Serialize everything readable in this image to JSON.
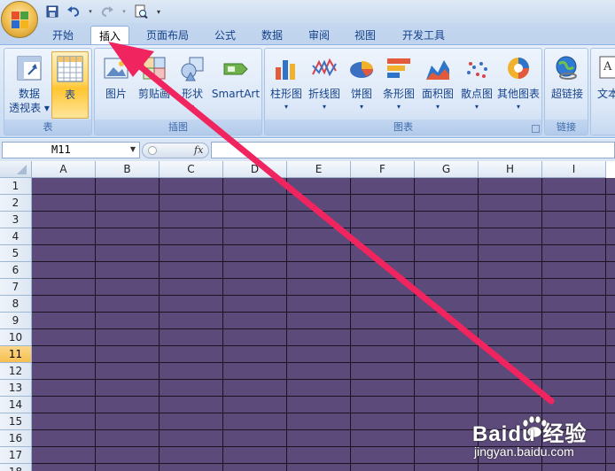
{
  "quick_access": {
    "items": [
      "save-icon",
      "undo-icon",
      "redo-icon",
      "print-preview-icon",
      "customize-icon"
    ]
  },
  "tabs": [
    {
      "label": "开始",
      "active": false
    },
    {
      "label": "插入",
      "active": true
    },
    {
      "label": "页面布局",
      "active": false
    },
    {
      "label": "公式",
      "active": false
    },
    {
      "label": "数据",
      "active": false
    },
    {
      "label": "审阅",
      "active": false
    },
    {
      "label": "视图",
      "active": false
    },
    {
      "label": "开发工具",
      "active": false
    }
  ],
  "ribbon": {
    "groups": {
      "table": {
        "label": "表",
        "buttons": [
          {
            "label": "数据",
            "label2": "透视表",
            "icon": "pivot-table-icon",
            "dropdown": true
          },
          {
            "label": "表",
            "icon": "table-icon",
            "highlighted": true
          }
        ]
      },
      "illustrations": {
        "label": "插图",
        "buttons": [
          {
            "label": "图片",
            "icon": "picture-icon"
          },
          {
            "label": "剪贴画",
            "icon": "clip-art-icon"
          },
          {
            "label": "形状",
            "icon": "shapes-icon",
            "dropdown": true
          },
          {
            "label": "SmartArt",
            "icon": "smartart-icon"
          }
        ]
      },
      "charts": {
        "label": "图表",
        "buttons": [
          {
            "label": "柱形图",
            "icon": "column-chart-icon",
            "dropdown": true
          },
          {
            "label": "折线图",
            "icon": "line-chart-icon",
            "dropdown": true
          },
          {
            "label": "饼图",
            "icon": "pie-chart-icon",
            "dropdown": true
          },
          {
            "label": "条形图",
            "icon": "bar-chart-icon",
            "dropdown": true
          },
          {
            "label": "面积图",
            "icon": "area-chart-icon",
            "dropdown": true
          },
          {
            "label": "散点图",
            "icon": "scatter-chart-icon",
            "dropdown": true
          },
          {
            "label": "其他图表",
            "icon": "other-charts-icon",
            "dropdown": true
          }
        ]
      },
      "links": {
        "label": "链接",
        "buttons": [
          {
            "label": "超链接",
            "icon": "hyperlink-icon"
          }
        ]
      },
      "text": {
        "buttons": [
          {
            "label": "文本",
            "icon": "text-box-icon"
          }
        ]
      }
    }
  },
  "formula_bar": {
    "name_box": "M11",
    "fx": "fx",
    "formula": ""
  },
  "sheet": {
    "columns": [
      "A",
      "B",
      "C",
      "D",
      "E",
      "F",
      "G",
      "H",
      "I"
    ],
    "rows": [
      "1",
      "2",
      "3",
      "4",
      "5",
      "6",
      "7",
      "8",
      "9",
      "10",
      "11",
      "12",
      "13",
      "14",
      "15",
      "16",
      "17",
      "18"
    ],
    "active_row": "11",
    "fill_color": "#5c4a7a",
    "gridline_color": "#1a1322"
  },
  "annotation": {
    "type": "arrow",
    "color": "#f0245e",
    "points_to": "插入"
  },
  "watermark": {
    "brand": "Baidu 经验",
    "url": "jingyan.baidu.com"
  }
}
